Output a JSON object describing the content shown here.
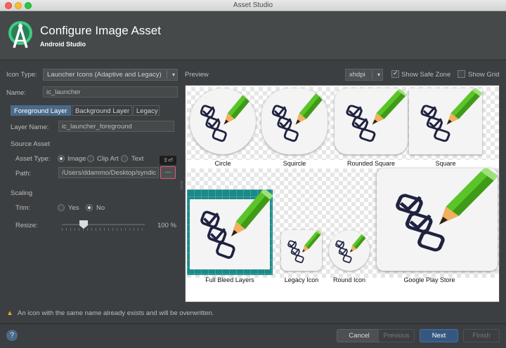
{
  "window": {
    "title": "Asset Studio"
  },
  "header": {
    "title": "Configure Image Asset",
    "subtitle": "Android Studio"
  },
  "form": {
    "icon_type_label": "Icon Type:",
    "icon_type_value": "Launcher Icons (Adaptive and Legacy)",
    "name_label": "Name:",
    "name_value": "ic_launcher",
    "tabs": [
      "Foreground Layer",
      "Background Layer",
      "Legacy"
    ],
    "layer_name_label": "Layer Name:",
    "layer_name_value": "ic_launcher_foreground",
    "source_asset_heading": "Source Asset",
    "asset_type_label": "Asset Type:",
    "asset_type_options": [
      "Image",
      "Clip Art",
      "Text"
    ],
    "path_label": "Path:",
    "path_value": "/Users/ddammo/Desktop/syndic",
    "browse_label": "...",
    "browse_shortcut": "⇧⏎",
    "scaling_heading": "Scaling",
    "trim_label": "Trim:",
    "trim_options": [
      "Yes",
      "No"
    ],
    "resize_label": "Resize:",
    "resize_value": "100 %",
    "resize_fraction": 0.25
  },
  "preview": {
    "label": "Preview",
    "density": "xhdpi",
    "show_safe_zone_label": "Show Safe Zone",
    "show_safe_zone": true,
    "show_grid_label": "Show Grid",
    "show_grid": false,
    "captions": [
      "Circle",
      "Squircle",
      "Rounded Square",
      "Square",
      "Full Bleed Layers",
      "Legacy Icon",
      "Round Icon",
      "Google Play Store"
    ]
  },
  "warning": "An icon with the same name already exists and will be overwritten.",
  "footer": {
    "help": "?",
    "cancel": "Cancel",
    "previous": "Previous",
    "next": "Next",
    "finish": "Finish"
  },
  "colors": {
    "accent": "#365880",
    "tab_active": "#4a6a8a",
    "warning": "#e0a030",
    "pencil_green": "#5ac528",
    "teal_bg": "#1a8a8a"
  }
}
